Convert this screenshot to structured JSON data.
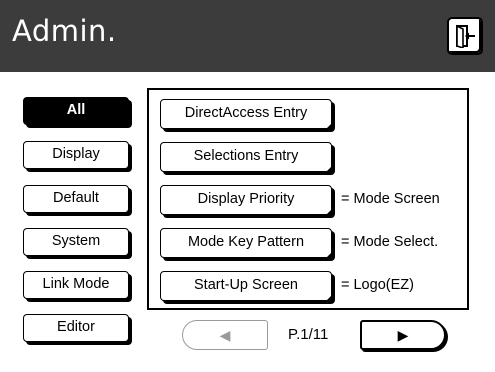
{
  "header": {
    "title": "Admin.",
    "exit_icon": "exit-door-icon"
  },
  "sidebar": {
    "items": [
      {
        "label": "All",
        "selected": true
      },
      {
        "label": "Display",
        "selected": false
      },
      {
        "label": "Default",
        "selected": false
      },
      {
        "label": "System",
        "selected": false
      },
      {
        "label": "Link Mode",
        "selected": false
      },
      {
        "label": "Editor",
        "selected": false
      }
    ]
  },
  "options": [
    {
      "label": "DirectAccess Entry",
      "value": ""
    },
    {
      "label": "Selections Entry",
      "value": ""
    },
    {
      "label": "Display Priority",
      "value": "= Mode Screen"
    },
    {
      "label": "Mode Key Pattern",
      "value": "= Mode Select."
    },
    {
      "label": "Start-Up Screen",
      "value": "= Logo(EZ)"
    }
  ],
  "pager": {
    "page_label": "P.1/11",
    "prev_icon": "◀",
    "next_icon": "▶",
    "prev_enabled": false
  },
  "colors": {
    "titlebar": "#3c3c3c",
    "title_text": "#ffffff",
    "disabled": "#9a9a9a"
  }
}
